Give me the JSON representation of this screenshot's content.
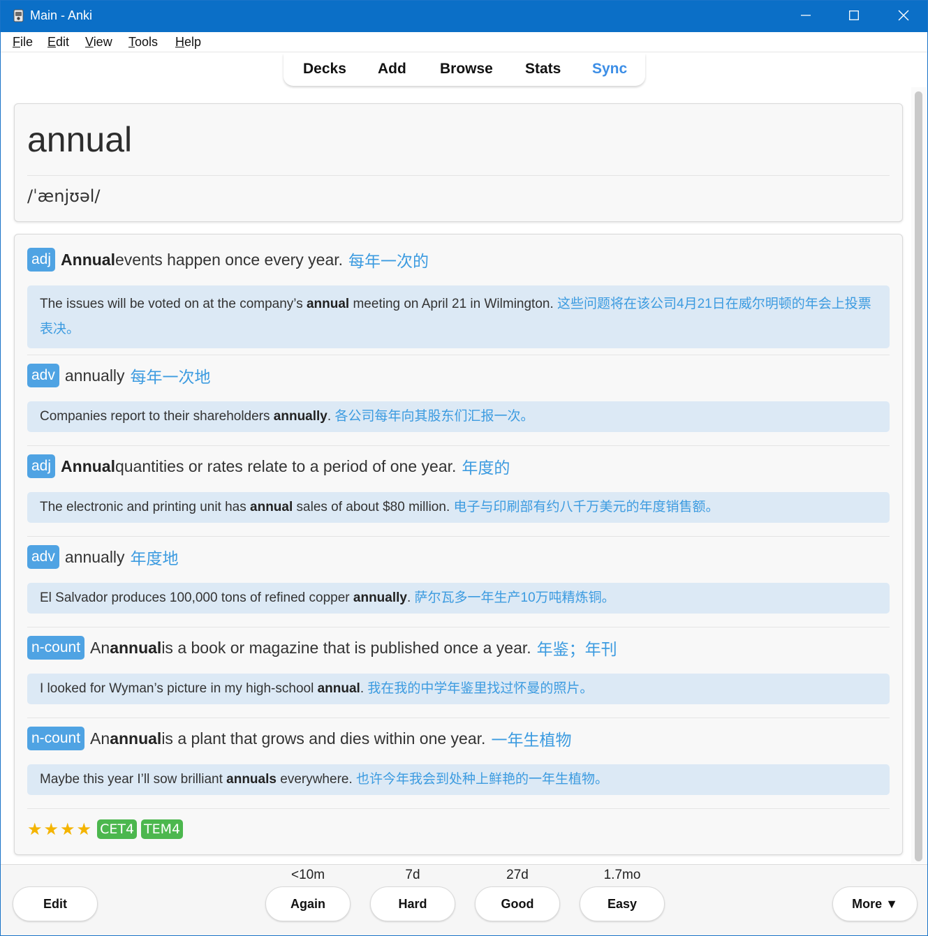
{
  "window": {
    "title": "Main - Anki"
  },
  "menu": [
    {
      "underline": "F",
      "rest": "ile"
    },
    {
      "underline": "E",
      "rest": "dit"
    },
    {
      "underline": "V",
      "rest": "iew"
    },
    {
      "underline": "T",
      "rest": "ools"
    },
    {
      "underline": "H",
      "rest": "elp"
    }
  ],
  "toolbar": {
    "decks": "Decks",
    "add": "Add",
    "browse": "Browse",
    "stats": "Stats",
    "sync": "Sync"
  },
  "card": {
    "word": "annual",
    "phonetic": "/ˈænjʊəl/",
    "senses": [
      {
        "pos": "adj",
        "def_pre": "",
        "def_bold": "Annual",
        "def_post": " events happen once every year.",
        "def_cn": "每年一次的",
        "ex_pre": "The issues will be voted on at the company’s ",
        "ex_bold": "annual",
        "ex_post": " meeting on April 21 in Wilmington. ",
        "ex_cn": "这些问题将在该公司4月21日在威尔明顿的年会上投票表决。"
      },
      {
        "pos": "adv",
        "def_pre": "annually",
        "def_bold": "",
        "def_post": "",
        "def_cn": "每年一次地",
        "ex_pre": "Companies report to their shareholders ",
        "ex_bold": "annually",
        "ex_post": ". ",
        "ex_cn": "各公司每年向其股东们汇报一次。"
      },
      {
        "pos": "adj",
        "def_pre": "",
        "def_bold": "Annual",
        "def_post": " quantities or rates relate to a period of one year.",
        "def_cn": "年度的",
        "ex_pre": "The electronic and printing unit has ",
        "ex_bold": "annual",
        "ex_post": " sales of about $80 million. ",
        "ex_cn": "电子与印刷部有约八千万美元的年度销售额。"
      },
      {
        "pos": "adv",
        "def_pre": "annually",
        "def_bold": "",
        "def_post": "",
        "def_cn": "年度地",
        "ex_pre": "El Salvador produces 100,000 tons of refined copper ",
        "ex_bold": "annually",
        "ex_post": ". ",
        "ex_cn": "萨尔瓦多一年生产10万吨精炼铜。"
      },
      {
        "pos": "n-count",
        "def_pre": "An ",
        "def_bold": "annual",
        "def_post": " is a book or magazine that is published once a year.",
        "def_cn": "年鉴；年刊",
        "ex_pre": "I looked for Wyman’s picture in my high-school ",
        "ex_bold": "annual",
        "ex_post": ". ",
        "ex_cn": "我在我的中学年鉴里找过怀曼的照片。"
      },
      {
        "pos": "n-count",
        "def_pre": "An ",
        "def_bold": "annual",
        "def_post": " is a plant that grows and dies within one year.",
        "def_cn": "一年生植物",
        "ex_pre": "Maybe this year I’ll sow brilliant ",
        "ex_bold": "annuals",
        "ex_post": " everywhere. ",
        "ex_cn": "也许今年我会到处种上鲜艳的一年生植物。"
      }
    ],
    "star_count": 4,
    "tags": [
      "CET4",
      "TEM4"
    ]
  },
  "bottom": {
    "edit": "Edit",
    "again": "Again",
    "again_time": "<10m",
    "hard": "Hard",
    "hard_time": "7d",
    "good": "Good",
    "good_time": "27d",
    "easy": "Easy",
    "easy_time": "1.7mo",
    "more": "More ▼"
  },
  "colors": {
    "titlebar": "#0b6fc7",
    "accent": "#3c9be0",
    "pos_badge": "#4fa3e3",
    "tag": "#4cb74e",
    "star": "#f4b400",
    "example_bg": "#dce9f5"
  }
}
